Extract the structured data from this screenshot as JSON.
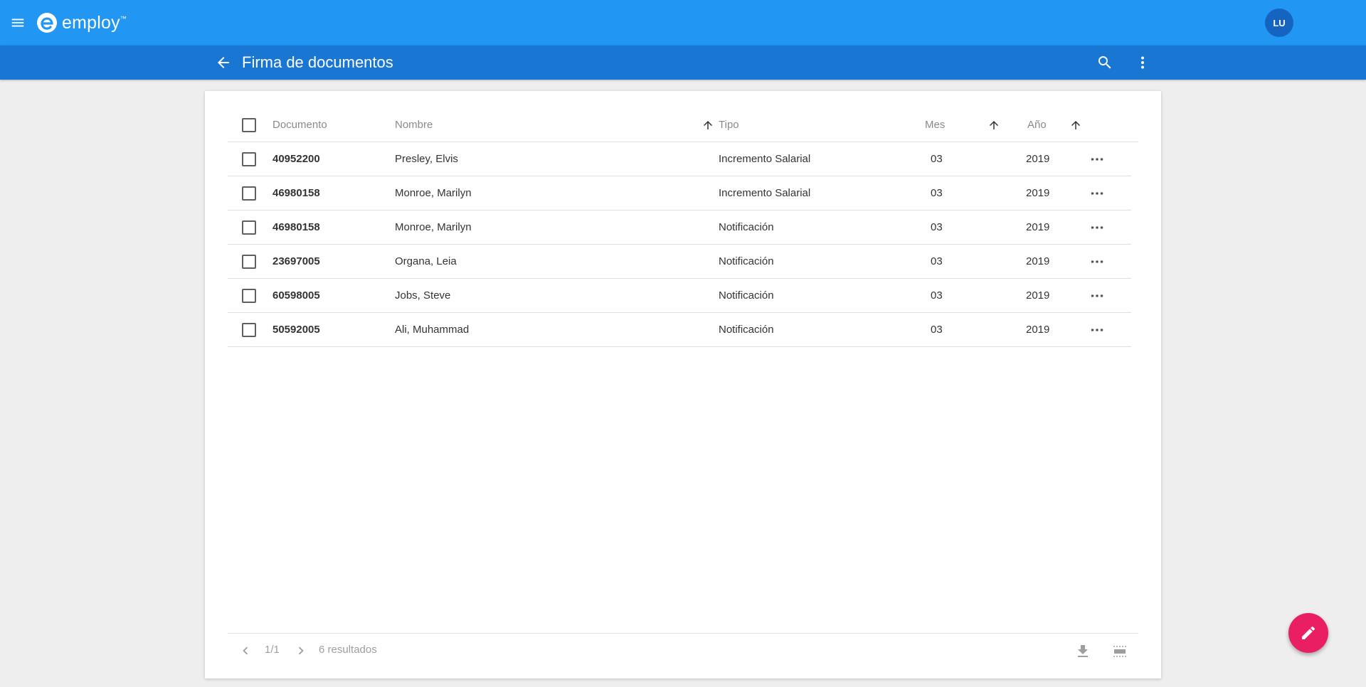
{
  "appbar": {
    "brand": "employ",
    "brand_mark": "™",
    "avatar_initials": "LU",
    "color": "#2196f3"
  },
  "subbar": {
    "title": "Firma de documentos",
    "color": "#1976d2"
  },
  "table": {
    "columns": {
      "documento": "Documento",
      "nombre": "Nombre",
      "tipo": "Tipo",
      "mes": "Mes",
      "anio": "Año"
    },
    "rows": [
      {
        "documento": "40952200",
        "nombre": "Presley, Elvis",
        "tipo": "Incremento Salarial",
        "mes": "03",
        "anio": "2019"
      },
      {
        "documento": "46980158",
        "nombre": "Monroe, Marilyn",
        "tipo": "Incremento Salarial",
        "mes": "03",
        "anio": "2019"
      },
      {
        "documento": "46980158",
        "nombre": "Monroe, Marilyn",
        "tipo": "Notificación",
        "mes": "03",
        "anio": "2019"
      },
      {
        "documento": "23697005",
        "nombre": "Organa, Leia",
        "tipo": "Notificación",
        "mes": "03",
        "anio": "2019"
      },
      {
        "documento": "60598005",
        "nombre": "Jobs, Steve",
        "tipo": "Notificación",
        "mes": "03",
        "anio": "2019"
      },
      {
        "documento": "50592005",
        "nombre": "Ali, Muhammad",
        "tipo": "Notificación",
        "mes": "03",
        "anio": "2019"
      }
    ]
  },
  "footer": {
    "page": "1/1",
    "results": "6 resultados"
  },
  "fab": {
    "icon": "pencil-icon",
    "color": "#e91e63"
  }
}
